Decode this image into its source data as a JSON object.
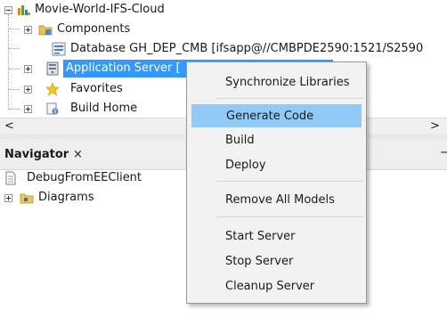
{
  "tree": {
    "root_label": "Movie-World-IFS-Cloud",
    "items": [
      {
        "label": "Components",
        "icon": "folder-components-icon"
      },
      {
        "label": "Database GH_DEP_CMB [ifsapp@//CMBPDE2590:1521/S2590",
        "icon": "database-icon"
      },
      {
        "label": "Application Server [",
        "icon": "server-icon"
      },
      {
        "label": "Favorites",
        "icon": "star-icon"
      },
      {
        "label": "Build Home",
        "icon": "build-home-icon"
      }
    ]
  },
  "scrollbar": {
    "left_arrow": "<",
    "right_arrow": ">"
  },
  "navigator": {
    "title": "Navigator",
    "close": "×",
    "minimize": "−",
    "items": [
      {
        "label": "DebugFromEEClient",
        "icon": "document-icon"
      },
      {
        "label": "Diagrams",
        "icon": "diagrams-folder-icon"
      }
    ]
  },
  "context_menu": {
    "items": [
      {
        "label": "Synchronize Libraries"
      },
      {
        "label": "Generate Code"
      },
      {
        "label": "Build"
      },
      {
        "label": "Deploy"
      },
      {
        "label": "Remove All Models"
      },
      {
        "label": "Start Server"
      },
      {
        "label": "Stop Server"
      },
      {
        "label": "Cleanup Server"
      }
    ],
    "highlighted_index": 1,
    "highlight_color": "#91c9f7"
  },
  "colors": {
    "selection": "#3399ff",
    "menu_bg": "#f2f2f2"
  }
}
